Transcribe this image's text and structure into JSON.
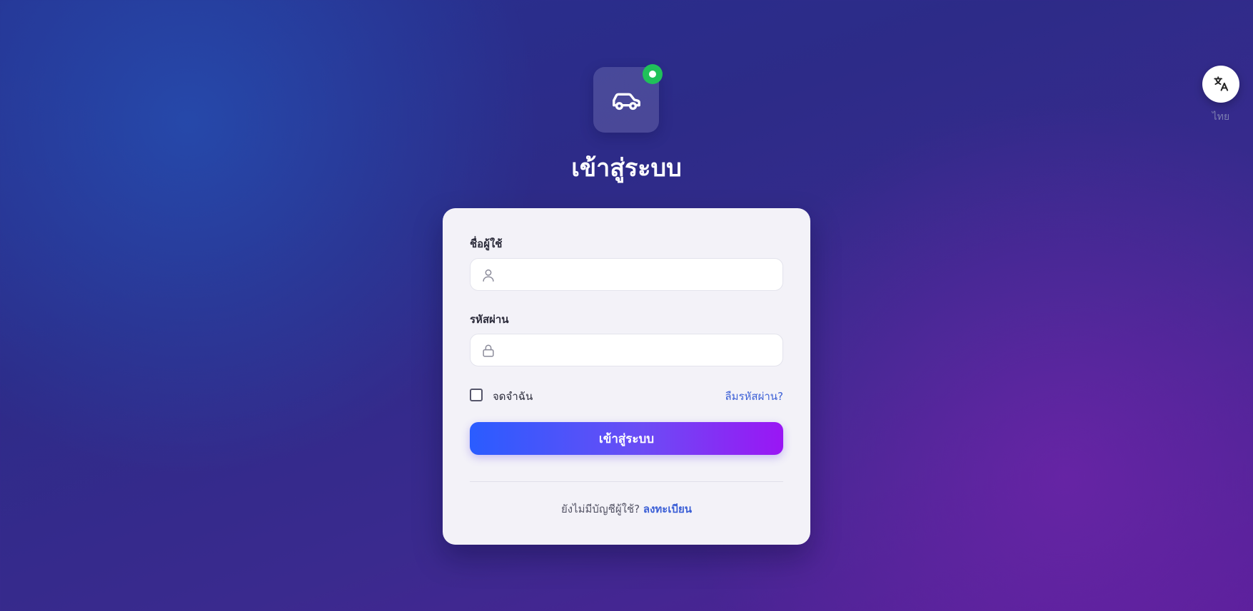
{
  "header": {
    "title": "เข้าสู่ระบบ",
    "logo_icon": "car-icon",
    "status_color": "#20c15a"
  },
  "language": {
    "icon": "translate-icon",
    "label": "ไทย"
  },
  "form": {
    "username": {
      "label": "ชื่อผู้ใช้",
      "value": "",
      "placeholder": "",
      "icon": "user-icon"
    },
    "password": {
      "label": "รหัสผ่าน",
      "value": "",
      "placeholder": "",
      "icon": "lock-icon"
    },
    "remember": {
      "label": "จดจำฉัน",
      "checked": false
    },
    "forgot_label": "ลืมรหัสผ่าน?",
    "submit_label": "เข้าสู่ระบบ"
  },
  "signup": {
    "prompt": "ยังไม่มีบัญชีผู้ใช้?",
    "link_label": "ลงทะเบียน"
  },
  "colors": {
    "accent": "#3b5fd6",
    "button_start": "#2a5cff",
    "button_end": "#9a16f4"
  }
}
